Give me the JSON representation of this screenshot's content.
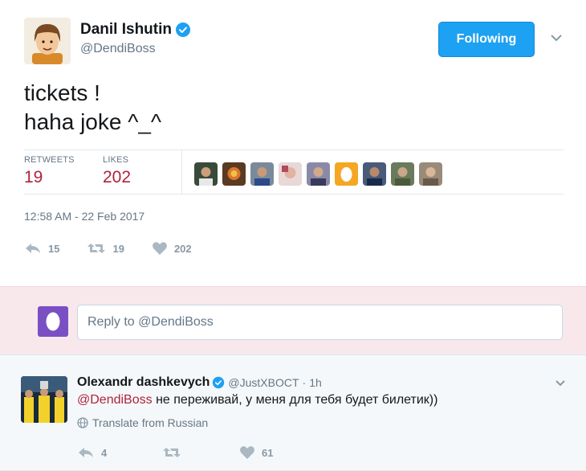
{
  "tweet": {
    "author_name": "Danil Ishutin",
    "author_handle": "@DendiBoss",
    "follow_label": "Following",
    "text_lines": [
      "tickets !",
      "haha joke ^_^"
    ],
    "timestamp": "12:58 AM - 22 Feb 2017",
    "stats": {
      "retweets_label": "RETWEETS",
      "retweets_value": "19",
      "likes_label": "LIKES",
      "likes_value": "202"
    },
    "actions": {
      "reply_count": "15",
      "retweet_count": "19",
      "like_count": "202"
    }
  },
  "reply_box": {
    "placeholder": "Reply to @DendiBoss"
  },
  "reply": {
    "author_name": "Olexandr dashkevych",
    "author_handle": "@JustXBOCT",
    "separator": "·",
    "time": "1h",
    "mention": "@DendiBoss",
    "text": " не переживай, у меня для тебя будет билетик))",
    "translate_label": "Translate from Russian",
    "actions": {
      "reply_count": "4",
      "retweet_count": "",
      "like_count": "61"
    }
  },
  "colors": {
    "brand_blue": "#1da1f2",
    "count_red": "#b0223b",
    "reply_area_bg": "#f8e8ec",
    "reply_avatar_purple": "#7a4fc4"
  }
}
